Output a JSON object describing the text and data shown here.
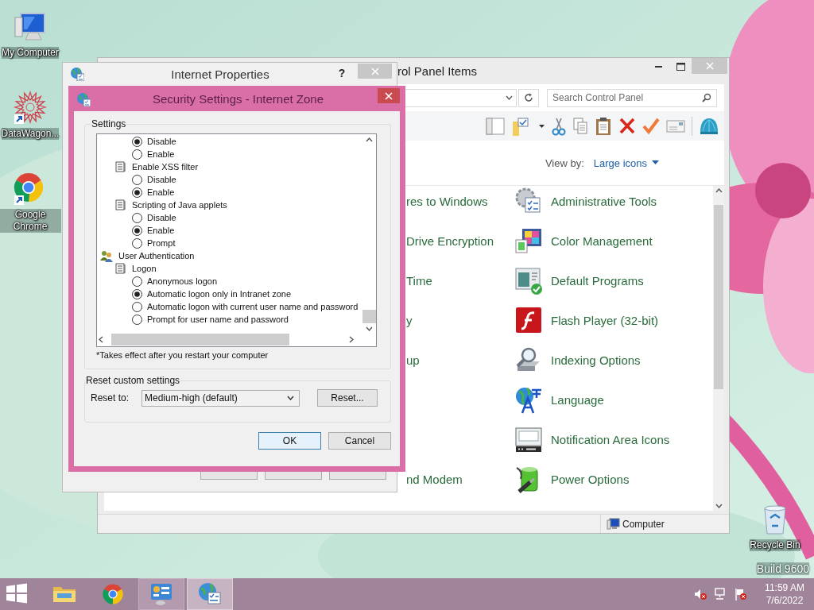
{
  "desktop": {
    "icons": [
      {
        "label": "My Computer",
        "kind": "computer"
      },
      {
        "label": "DataWagon...",
        "kind": "datawagon"
      },
      {
        "label": "Google Chrome",
        "kind": "chrome"
      },
      {
        "label": "Recycle Bin",
        "kind": "recycle"
      }
    ],
    "build": "Build 9600"
  },
  "control_panel": {
    "title": "rol Panel Items",
    "search": {
      "placeholder": "Search Control Panel"
    },
    "view_by": {
      "label": "View by:",
      "value": "Large icons"
    },
    "items": [
      {
        "left": "res to Windows",
        "right": "Administrative Tools",
        "kind": "admin-tools"
      },
      {
        "left": "Drive Encryption",
        "right": "Color Management",
        "kind": "color"
      },
      {
        "left": "Time",
        "right": "Default Programs",
        "kind": "default-programs"
      },
      {
        "left": "y",
        "right": "Flash Player (32-bit)",
        "kind": "flash"
      },
      {
        "left": "up",
        "right": "Indexing Options",
        "kind": "indexing"
      },
      {
        "right": "Language",
        "kind": "language"
      },
      {
        "right": "Notification Area Icons",
        "kind": "notification"
      },
      {
        "left": "nd Modem",
        "right": "Power Options",
        "kind": "power"
      }
    ],
    "status": "Computer"
  },
  "internet_properties": {
    "title": "Internet Properties",
    "help": "?"
  },
  "security_dialog": {
    "title": "Security Settings - Internet Zone",
    "settings_label": "Settings",
    "items": [
      {
        "kind": "radio",
        "label": "Disable",
        "selected": true
      },
      {
        "kind": "radio",
        "label": "Enable",
        "selected": false
      },
      {
        "kind": "setting",
        "label": "Enable XSS filter",
        "children": [
          {
            "kind": "radio",
            "label": "Disable",
            "selected": false
          },
          {
            "kind": "radio",
            "label": "Enable",
            "selected": true
          }
        ]
      },
      {
        "kind": "setting",
        "label": "Scripting of Java applets",
        "children": [
          {
            "kind": "radio",
            "label": "Disable",
            "selected": false
          },
          {
            "kind": "radio",
            "label": "Enable",
            "selected": true
          },
          {
            "kind": "radio",
            "label": "Prompt",
            "selected": false
          }
        ]
      },
      {
        "kind": "group",
        "label": "User Authentication",
        "children": [
          {
            "kind": "setting",
            "label": "Logon",
            "children": [
              {
                "kind": "radio",
                "label": "Anonymous logon",
                "selected": false
              },
              {
                "kind": "radio",
                "label": "Automatic logon only in Intranet zone",
                "selected": true
              },
              {
                "kind": "radio",
                "label": "Automatic logon with current user name and password",
                "selected": false
              },
              {
                "kind": "radio",
                "label": "Prompt for user name and password",
                "selected": false
              }
            ]
          }
        ]
      }
    ],
    "note": "*Takes effect after you restart your computer",
    "reset_group_label": "Reset custom settings",
    "reset_to_label": "Reset to:",
    "reset_to_value": "Medium-high (default)",
    "reset_button": "Reset...",
    "buttons": [
      {
        "label": "OK",
        "default": true
      },
      {
        "label": "Cancel",
        "default": false
      }
    ]
  },
  "taskbar": {
    "apps": [
      {
        "kind": "start"
      },
      {
        "kind": "explorer",
        "open": false,
        "selected": false
      },
      {
        "kind": "chrome",
        "open": false,
        "selected": false
      },
      {
        "kind": "control-panel",
        "open": true,
        "selected": false
      },
      {
        "kind": "internet-properties",
        "open": true,
        "selected": true
      }
    ],
    "tray": [
      {
        "kind": "volume-muted"
      },
      {
        "kind": "network"
      },
      {
        "kind": "flag-alert"
      }
    ],
    "clock": {
      "time": "11:59 AM",
      "date": "7/6/2022"
    }
  }
}
